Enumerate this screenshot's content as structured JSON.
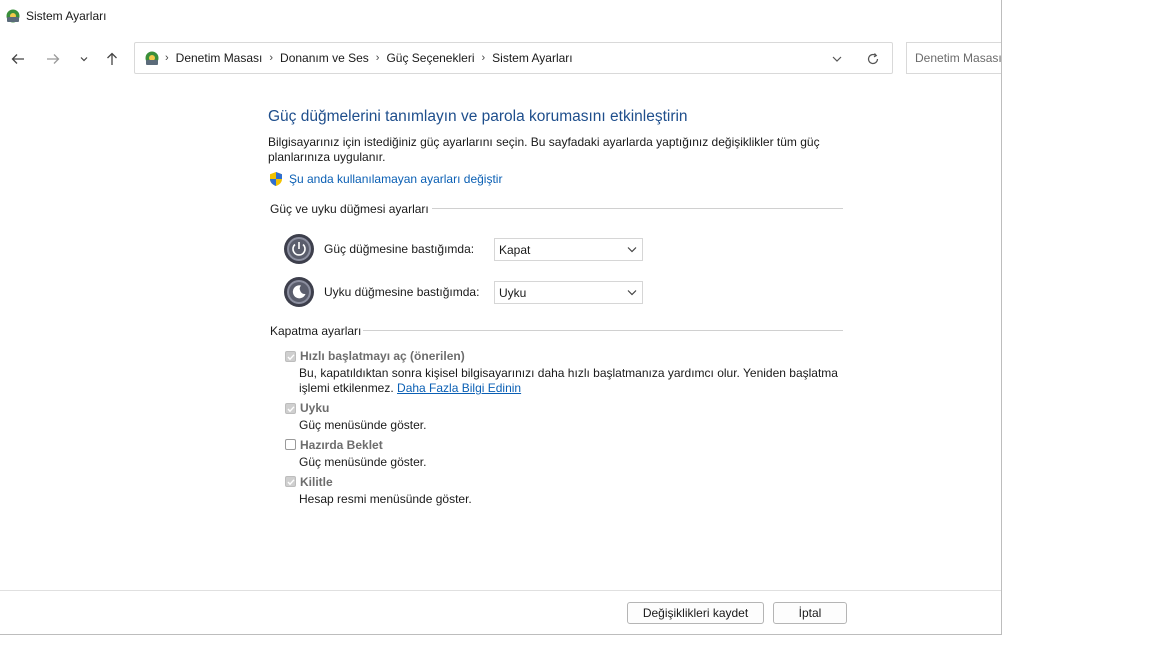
{
  "window": {
    "title": "Sistem Ayarları"
  },
  "nav": {
    "back_label": "←",
    "forward_label": "→",
    "recent_label": "⌄",
    "up_label": "↑"
  },
  "address": {
    "crumbs": [
      "Denetim Masası",
      "Donanım ve Ses",
      "Güç Seçenekleri",
      "Sistem Ayarları"
    ],
    "separator": "›"
  },
  "search": {
    "placeholder": "Denetim Masası"
  },
  "main": {
    "heading": "Güç düğmelerini tanımlayın ve parola korumasını etkinleştirin",
    "description": "Bilgisayarınız için istediğiniz güç ayarlarını seçin. Bu sayfadaki ayarlarda yaptığınız değişiklikler tüm güç planlarınıza uygulanır.",
    "unavailable_link": "Şu anda kullanılamayan ayarları değiştir"
  },
  "power_section": {
    "title": "Güç ve uyku düğmesi ayarları",
    "power_label": "Güç düğmesine bastığımda:",
    "power_value": "Kapat",
    "sleep_label": "Uyku düğmesine bastığımda:",
    "sleep_value": "Uyku"
  },
  "shutdown_section": {
    "title": "Kapatma ayarları",
    "fast_startup": {
      "title": "Hızlı başlatmayı aç (önerilen)",
      "desc": "Bu, kapatıldıktan sonra kişisel bilgisayarınızı daha hızlı başlatmanıza yardımcı olur. Yeniden başlatma işlemi etkilenmez. ",
      "link": "Daha Fazla Bilgi Edinin",
      "checked": true
    },
    "sleep": {
      "title": "Uyku",
      "desc": "Güç menüsünde göster.",
      "checked": true
    },
    "hibernate": {
      "title": "Hazırda Beklet",
      "desc": "Güç menüsünde göster.",
      "checked": false
    },
    "lock": {
      "title": "Kilitle",
      "desc": "Hesap resmi menüsünde göster.",
      "checked": true
    }
  },
  "footer": {
    "save_label": "Değişiklikleri kaydet",
    "cancel_label": "İptal"
  },
  "colors": {
    "heading": "#1e4e8c",
    "link": "#0a5fb4",
    "disabled_text": "#6d6d6d"
  }
}
